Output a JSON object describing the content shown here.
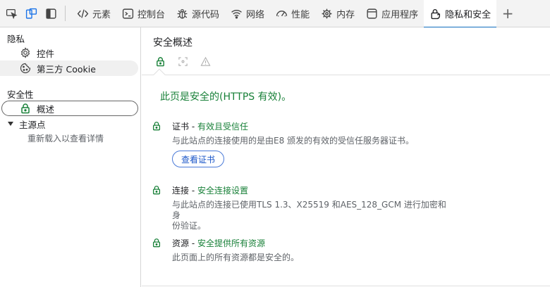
{
  "toolbar": {
    "tabs": [
      {
        "label": "元素",
        "icon": "code-icon"
      },
      {
        "label": "控制台",
        "icon": "console-icon"
      },
      {
        "label": "源代码",
        "icon": "bug-icon"
      },
      {
        "label": "网络",
        "icon": "wifi-icon"
      },
      {
        "label": "性能",
        "icon": "gauge-icon"
      },
      {
        "label": "内存",
        "icon": "memory-icon"
      },
      {
        "label": "应用程序",
        "icon": "app-icon"
      },
      {
        "label": "隐私和安全",
        "icon": "lock-shield-icon"
      }
    ],
    "accent": "#1a73e8"
  },
  "sidebar": {
    "privacy_heading": "隐私",
    "privacy_items": [
      "控件",
      "第三方 Cookie"
    ],
    "security_heading": "安全性",
    "security_item": "概述",
    "main_origin": "主源点",
    "reload_hint": "重新载入以查看详情"
  },
  "main": {
    "title": "安全概述",
    "summary": "此页是安全的(HTTPS 有效)。",
    "certificate": {
      "label": "证书",
      "status": "有效且受信任",
      "desc": "与此站点的连接使用的是由E8 颁发的有效的受信任服务器证书。",
      "button": "查看证书"
    },
    "connection": {
      "label": "连接",
      "status": "安全连接设置",
      "desc_line1": "与此站点的连接已使用TLS 1.3、X25519 和AES_128_GCM 进行加密和身",
      "desc_line2": "份验证。"
    },
    "resources": {
      "label": "资源",
      "status": "安全提供所有资源",
      "desc": "此页面上的所有资源都是安全的。"
    },
    "separator": " - ",
    "good_color": "#188038"
  }
}
